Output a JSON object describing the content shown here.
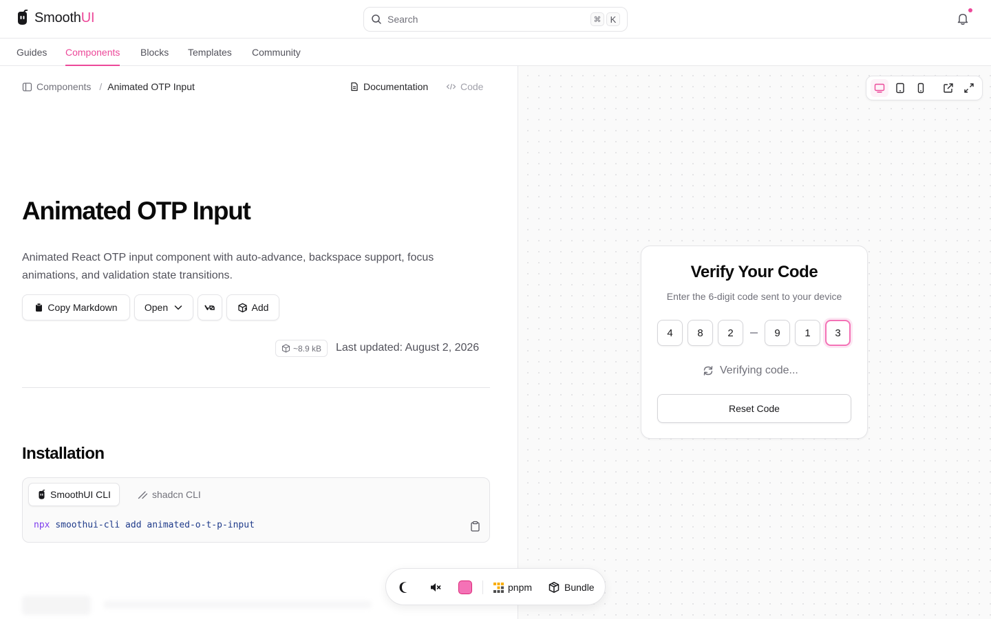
{
  "header": {
    "brand_prefix": "Smooth",
    "brand_accent": "UI",
    "search_placeholder": "Search",
    "shortcut_modifier": "⌘",
    "shortcut_key": "K"
  },
  "nav": {
    "tabs": [
      {
        "label": "Guides",
        "active": false
      },
      {
        "label": "Components",
        "active": true
      },
      {
        "label": "Blocks",
        "active": false
      },
      {
        "label": "Templates",
        "active": false
      },
      {
        "label": "Community",
        "active": false
      }
    ]
  },
  "breadcrumb": {
    "root": "Components",
    "separator": "/",
    "current": "Animated OTP Input"
  },
  "page_links": {
    "documentation": "Documentation",
    "code": "Code"
  },
  "page": {
    "title": "Animated OTP Input",
    "description": "Animated React OTP input component with auto-advance, backspace support, focus animations, and validation state transitions.",
    "actions": {
      "copy_markdown": "Copy Markdown",
      "open": "Open",
      "v0": "v0",
      "add": "Add"
    },
    "bundle_size": "~8.9 kB",
    "last_updated": "Last updated: August 2, 2026"
  },
  "installation": {
    "title": "Installation",
    "tabs": [
      "SmoothUI CLI",
      "shadcn CLI"
    ],
    "command_prefix": "npx",
    "command_rest": "smoothui-cli add animated-o-t-p-input"
  },
  "preview": {
    "title": "Verify Your Code",
    "subtitle": "Enter the 6-digit code sent to your device",
    "digits": [
      "4",
      "8",
      "2",
      "9",
      "1",
      "3"
    ],
    "status": "Verifying code...",
    "reset_label": "Reset Code"
  },
  "toolbar": {
    "package_manager": "pnpm",
    "bundle": "Bundle"
  },
  "colors": {
    "accent": "#ec4899",
    "swatch": "#f472b6"
  },
  "icons": [
    "logo-icon",
    "search-icon",
    "bell-icon",
    "sidebar-icon",
    "document-icon",
    "code-icon",
    "clipboard-icon",
    "chevron-down-icon",
    "v0-icon",
    "package-icon",
    "wand-icon",
    "desktop-icon",
    "tablet-icon",
    "mobile-icon",
    "external-link-icon",
    "expand-icon",
    "refresh-icon",
    "moon-icon",
    "mute-icon",
    "pnpm-icon",
    "box-icon"
  ]
}
